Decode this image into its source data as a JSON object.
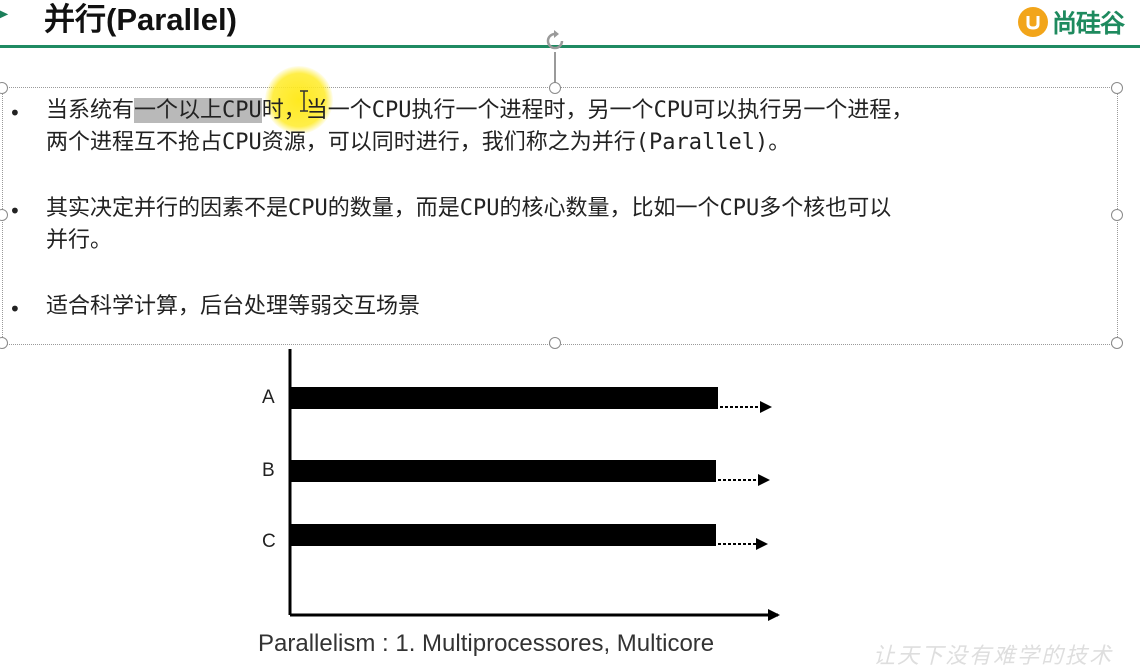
{
  "header": {
    "title": "并行(Parallel)",
    "logo_text": "尚硅谷"
  },
  "bullets": [
    {
      "lines": [
        {
          "segments": [
            {
              "text": "当系统有",
              "mono": false,
              "hl": false
            },
            {
              "text": "一个以上",
              "mono": false,
              "hl": true
            },
            {
              "text": "CPU",
              "mono": true,
              "hl": true
            },
            {
              "text": "时，当一个",
              "mono": false,
              "hl": false
            },
            {
              "text": "CPU",
              "mono": true,
              "hl": false
            },
            {
              "text": "执行一个进程时，另一个",
              "mono": false,
              "hl": false
            },
            {
              "text": "CPU",
              "mono": true,
              "hl": false
            },
            {
              "text": "可以执行另一个进程，",
              "mono": false,
              "hl": false
            }
          ]
        },
        {
          "segments": [
            {
              "text": "两个进程互不抢占",
              "mono": false,
              "hl": false
            },
            {
              "text": "CPU",
              "mono": true,
              "hl": false
            },
            {
              "text": "资源，可以同时进行，我们称之为并行",
              "mono": false,
              "hl": false
            },
            {
              "text": "(Parallel)",
              "mono": true,
              "hl": false
            },
            {
              "text": "。",
              "mono": false,
              "hl": false
            }
          ]
        }
      ]
    },
    {
      "lines": [
        {
          "segments": [
            {
              "text": "其实决定并行的因素不是",
              "mono": false,
              "hl": false
            },
            {
              "text": "CPU",
              "mono": true,
              "hl": false
            },
            {
              "text": "的数量，而是",
              "mono": false,
              "hl": false
            },
            {
              "text": "CPU",
              "mono": true,
              "hl": false
            },
            {
              "text": "的核心数量，比如一个",
              "mono": false,
              "hl": false
            },
            {
              "text": "CPU",
              "mono": true,
              "hl": false
            },
            {
              "text": "多个核也可以",
              "mono": false,
              "hl": false
            }
          ]
        },
        {
          "segments": [
            {
              "text": "并行。",
              "mono": false,
              "hl": false
            }
          ]
        }
      ]
    },
    {
      "lines": [
        {
          "segments": [
            {
              "text": "适合科学计算，后台处理等弱交互场景",
              "mono": false,
              "hl": false
            }
          ]
        }
      ]
    }
  ],
  "diagram": {
    "rows": [
      {
        "label": "A"
      },
      {
        "label": "B"
      },
      {
        "label": "C"
      }
    ],
    "caption": "Parallelism : 1. Multiprocessores, Multicore"
  },
  "watermark": "让天下没有难学的技术",
  "colors": {
    "accent": "#1f8a62",
    "logo_orange": "#f2a51a",
    "highlight": "#b9b9b9",
    "cursor_yellow": "#ffe814"
  }
}
